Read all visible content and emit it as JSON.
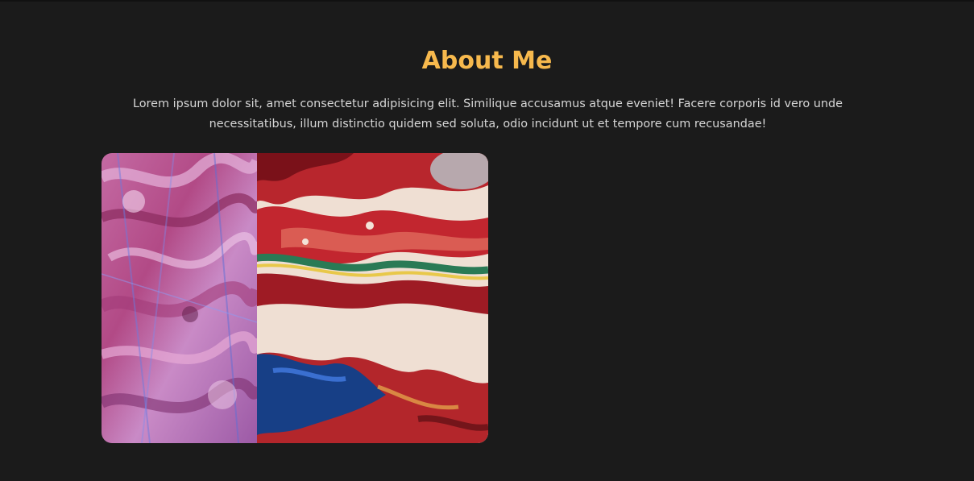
{
  "about": {
    "title": "About Me",
    "description": "Lorem ipsum dolor sit, amet consectetur adipisicing elit. Similique accusamus atque eveniet! Facere corporis id vero unde necessitatibus, illum distinctio quidem sed soluta, odio incidunt ut et tempore cum recusandae!"
  },
  "gallery": {
    "images": [
      {
        "name": "pink-purple-abstract-painting"
      },
      {
        "name": "red-marbled-fluid-art"
      }
    ]
  },
  "colors": {
    "background": "#1b1b1b",
    "accent": "#f7b94d",
    "text": "#d6d6d6"
  }
}
